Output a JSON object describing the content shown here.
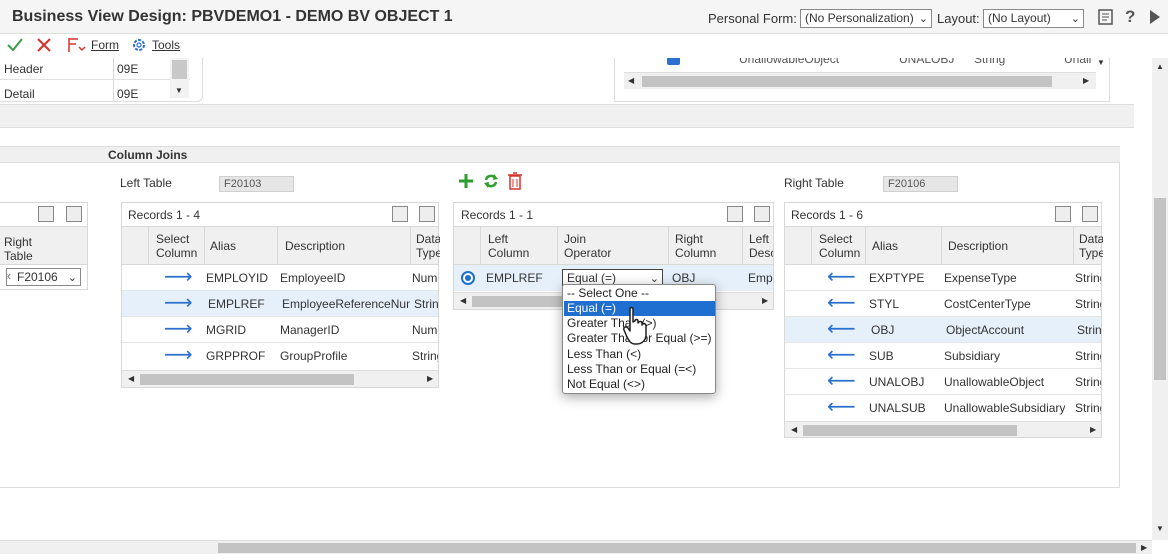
{
  "window": {
    "title": "Business View Design: PBVDEMO1 - DEMO BV OBJECT 1",
    "personal_form_label": "Personal Form:",
    "personal_form_value": "(No Personalization)",
    "layout_label": "Layout:",
    "layout_value": "(No Layout)",
    "help_glyph": "?"
  },
  "toolbar": {
    "form_label": "Form",
    "tools_label": "Tools"
  },
  "top_left_rows": [
    {
      "name": "Header",
      "code": "09E"
    },
    {
      "name": "Detail",
      "code": "09E"
    }
  ],
  "top_right_row": {
    "col1": "UnallowableObject",
    "col2": "UNALOBJ",
    "col3": "String",
    "col4": "Unall"
  },
  "column_joins": {
    "section_title": "Column Joins",
    "left_table_label": "Left Table",
    "left_table_value": "F20103",
    "right_table_label": "Right Table",
    "right_table_value": "F20106"
  },
  "far_left": {
    "header1": "Right",
    "header2": "Table",
    "select_value": "F20106"
  },
  "left_grid": {
    "records": "Records 1 - 4",
    "headers": [
      "Select Column",
      "Alias",
      "Description",
      "Data Type"
    ],
    "rows": [
      {
        "alias": "EMPLOYID",
        "desc": "EmployeeID",
        "type": "Nume"
      },
      {
        "alias": "EMPLREF",
        "desc": "EmployeeReferenceNum",
        "type": "String"
      },
      {
        "alias": "MGRID",
        "desc": "ManagerID",
        "type": "Nume"
      },
      {
        "alias": "GRPPROF",
        "desc": "GroupProfile",
        "type": "String"
      }
    ]
  },
  "middle_grid": {
    "records": "Records 1 - 1",
    "headers": [
      "Left Column",
      "Join Operator",
      "Right Column",
      "Left Desc"
    ],
    "row": {
      "left_col": "EMPLREF",
      "operator": "Equal (=)",
      "right_col": "OBJ",
      "left_desc": "Empl"
    }
  },
  "join_operator_options": [
    "-- Select One --",
    "Equal (=)",
    "Greater Than (>)",
    "Greater Than or Equal (>=)",
    "Less Than (<)",
    "Less Than or Equal (=<)",
    "Not Equal (<>)"
  ],
  "right_grid": {
    "records": "Records 1 - 6",
    "headers": [
      "Select Column",
      "Alias",
      "Description",
      "Data Type"
    ],
    "rows": [
      {
        "alias": "EXPTYPE",
        "desc": "ExpenseType",
        "type": "String"
      },
      {
        "alias": "STYL",
        "desc": "CostCenterType",
        "type": "String"
      },
      {
        "alias": "OBJ",
        "desc": "ObjectAccount",
        "type": "String"
      },
      {
        "alias": "SUB",
        "desc": "Subsidiary",
        "type": "String"
      },
      {
        "alias": "UNALOBJ",
        "desc": "UnallowableObject",
        "type": "String"
      },
      {
        "alias": "UNALSUB",
        "desc": "UnallowableSubsidiary",
        "type": "String"
      }
    ]
  },
  "colors": {
    "accent": "#2b6fcf",
    "selected_row": "#e6f0fa",
    "add_green": "#2e9e2e",
    "delete_red": "#d9322b"
  }
}
